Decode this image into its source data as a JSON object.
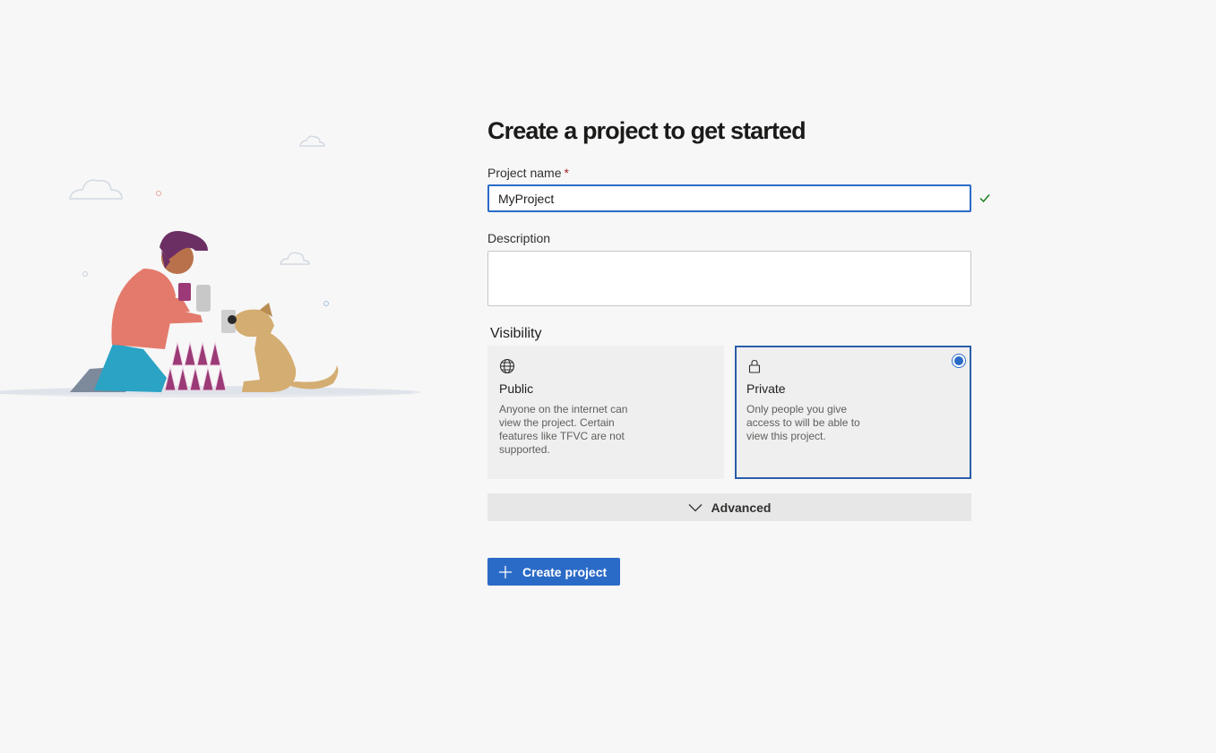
{
  "page": {
    "title": "Create a project to get started"
  },
  "form": {
    "project_name": {
      "label": "Project name",
      "required_marker": "*",
      "value": "MyProject"
    },
    "description": {
      "label": "Description",
      "value": ""
    },
    "visibility": {
      "label": "Visibility",
      "selected": "Private",
      "options": [
        {
          "name": "Public",
          "icon": "globe-icon",
          "description": "Anyone on the internet can view the project. Certain features like TFVC are not supported."
        },
        {
          "name": "Private",
          "icon": "lock-icon",
          "description": "Only people you give access to will be able to view this project."
        }
      ]
    },
    "advanced_label": "Advanced",
    "create_button_label": "Create project"
  },
  "colors": {
    "accent": "#2b6bc8",
    "selected_border": "#2b5da8",
    "required": "#a4262c",
    "valid_check": "#107c10",
    "background": "#f7f7f7"
  }
}
